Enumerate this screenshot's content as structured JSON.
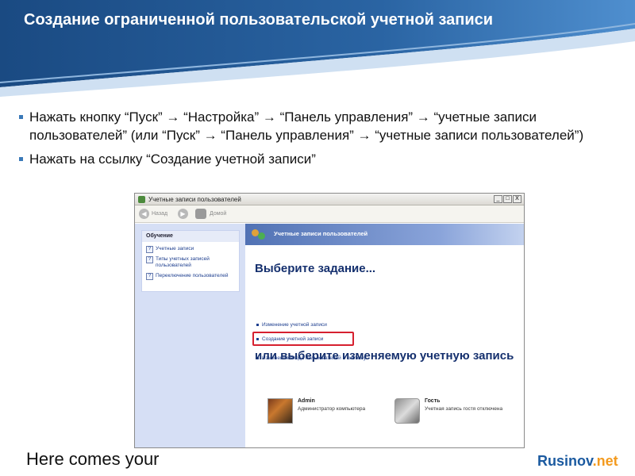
{
  "slide": {
    "title": "Создание ограниченной пользовательской учетной записи",
    "bullets": [
      "Нажать кнопку “Пуск” → “Настройка” → “Панель управления” → “учетные записи пользователей” (или “Пуск” → “Панель управления” → “учетные записи пользователей”)",
      "Нажать на ссылку “Создание учетной записи”"
    ],
    "footer_text": "Here comes your",
    "brand_name": "Rusinov",
    "brand_suffix": ".net"
  },
  "window": {
    "title": "Учетные записи пользователей",
    "controls": [
      "_",
      "□",
      "X"
    ],
    "toolbar": {
      "back_label": "Назад",
      "home_label": "Домой"
    },
    "sidebar": {
      "heading": "Обучение",
      "items": [
        "Учетные записи",
        "Типы учетных записей пользователей",
        "Переключение пользователей"
      ]
    },
    "banner_title": "Учетные записи пользователей",
    "task_heading": "Выберите задание...",
    "tasks": [
      "Изменение учетной записи",
      "Создание учетной записи",
      "Изменение входа пользователей в систему"
    ],
    "account_heading": "или выберите изменяемую учетную запись",
    "accounts": [
      {
        "name": "Admin",
        "description": "Администратор компьютера"
      },
      {
        "name": "Гость",
        "description": "Учетная запись гостя отключена"
      }
    ]
  },
  "colors": {
    "header_blue": "#1d4e87",
    "bullet_marker": "#3a79b8",
    "highlight_red": "#d6202f",
    "brand_blue": "#1b5aa0",
    "brand_orange": "#f39a1e",
    "xp_heading": "#15306e",
    "xp_link": "#1e3f8f"
  }
}
